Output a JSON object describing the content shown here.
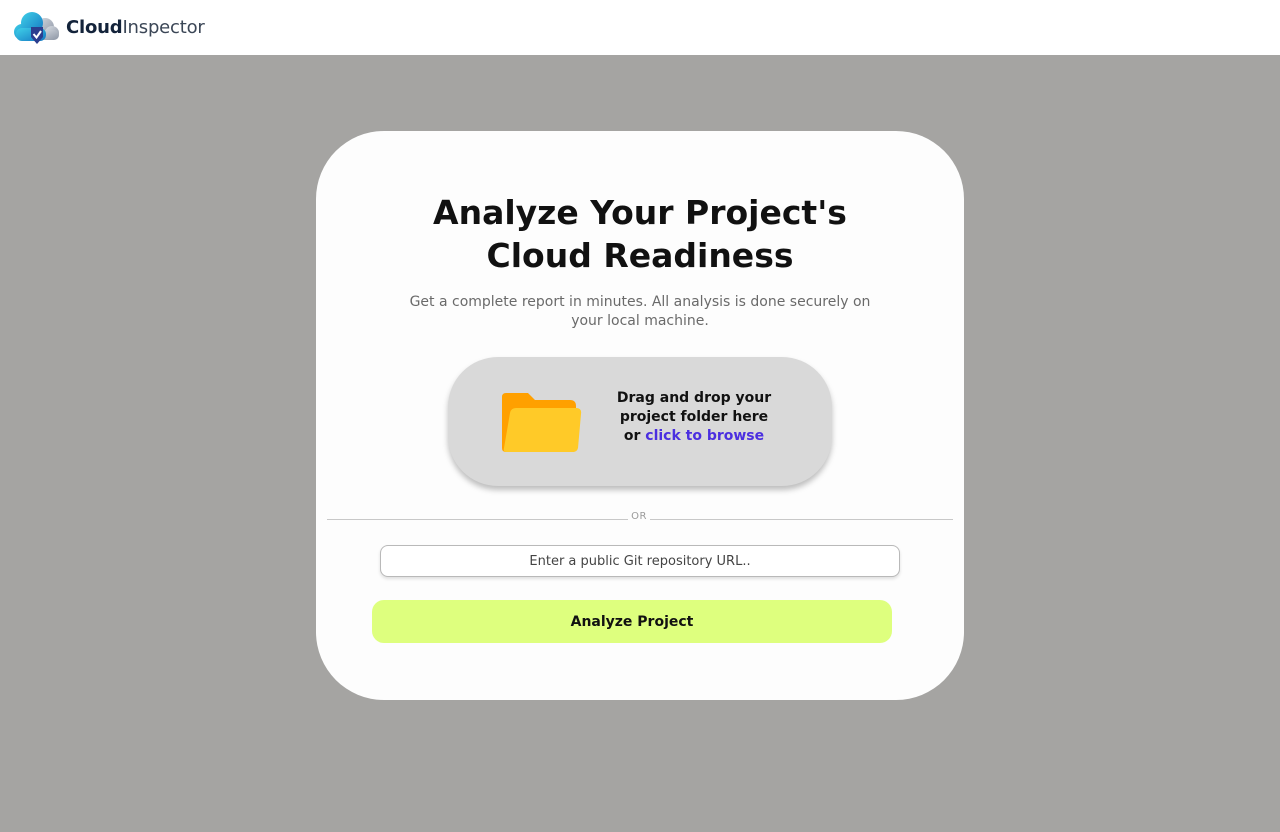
{
  "header": {
    "logo_bold": "Cloud",
    "logo_light": "Inspector"
  },
  "card": {
    "title": "Analyze Your Project's Cloud Readiness",
    "subtitle": "Get a complete report in minutes. All analysis is done securely on your local machine.",
    "dropzone": {
      "text_line": "Drag and drop your project folder here",
      "or_prefix": "or",
      "browse_link": "click to browse",
      "icon": "folder-icon"
    },
    "divider_label": "OR",
    "url_input": {
      "value": "",
      "placeholder": "Enter a public Git repository URL.."
    },
    "analyze_button": "Analyze Project"
  },
  "colors": {
    "page_background": "#a5a4a2",
    "card_background": "#fdfdfd",
    "dropzone_background": "#d9d9d9",
    "link": "#4b2fe0",
    "button": "#deff7e",
    "folder_back": "#ffa000",
    "folder_front": "#ffca28"
  }
}
